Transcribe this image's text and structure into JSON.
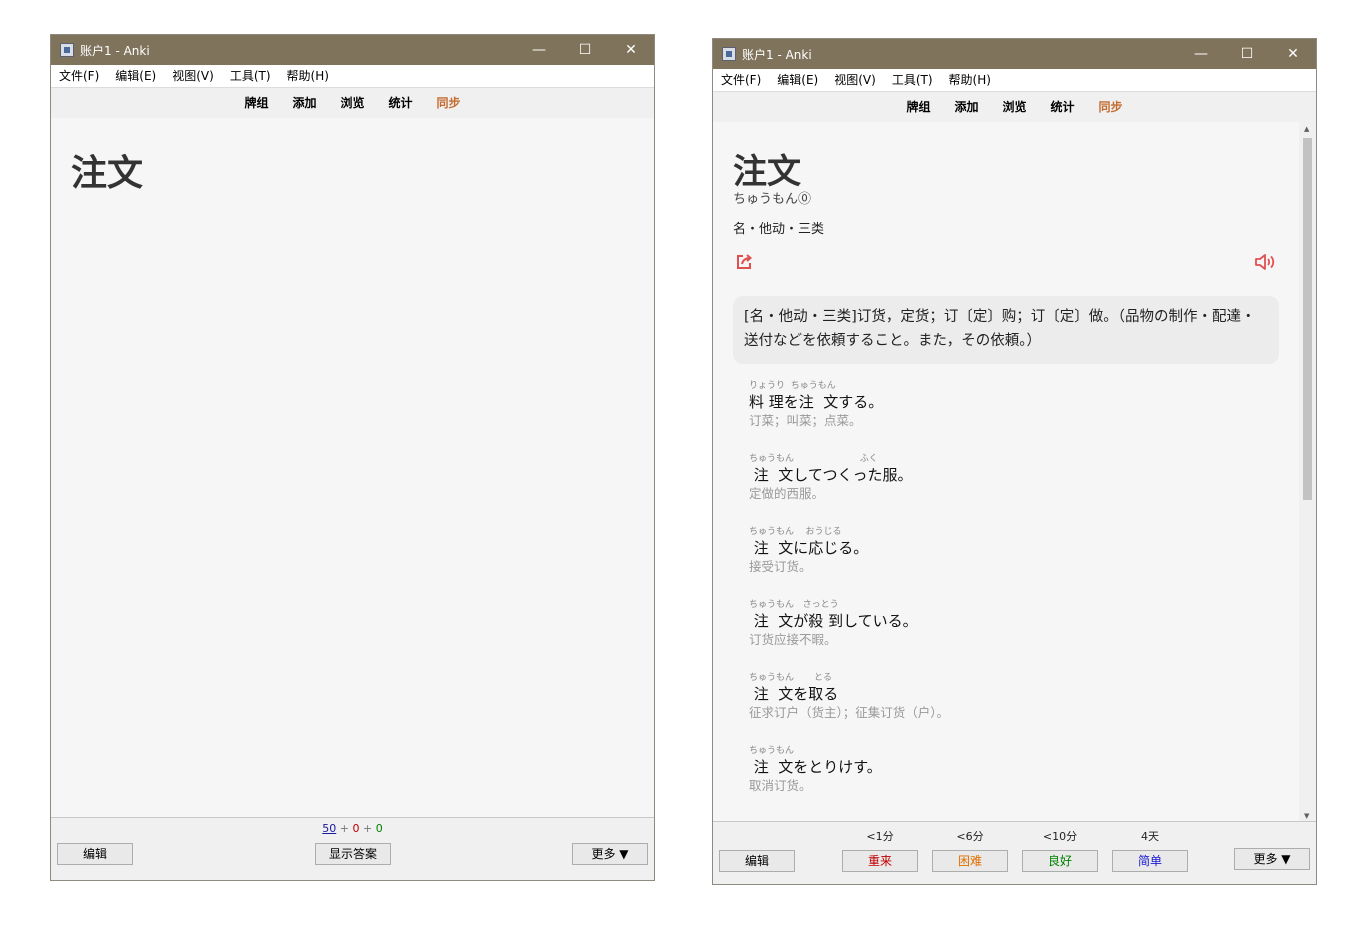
{
  "window_left": {
    "title": "账户1 - Anki",
    "menu": [
      "文件(F)",
      "编辑(E)",
      "视图(V)",
      "工具(T)",
      "帮助(H)"
    ],
    "toolbar": [
      "牌组",
      "添加",
      "浏览",
      "统计",
      "同步"
    ],
    "card_front": "注文",
    "counts": {
      "new": "50",
      "sep": "+",
      "learn": "0",
      "review": "0"
    },
    "edit_label": "编辑",
    "show_answer_label": "显示答案",
    "more_label": "更多 ▼"
  },
  "window_right": {
    "title": "账户1 - Anki",
    "menu": [
      "文件(F)",
      "编辑(E)",
      "视图(V)",
      "工具(T)",
      "帮助(H)"
    ],
    "toolbar": [
      "牌组",
      "添加",
      "浏览",
      "统计",
      "同步"
    ],
    "word": "注文",
    "reading": "ちゅうもん⓪",
    "part_of_speech": "名・他动・三类",
    "definition": "[名・他动・三类]订货，定货；订〔定〕购；订〔定〕做。（品物の制作・配達・送付などを依頼すること。また，その依頼。）",
    "examples": [
      {
        "ruby": "りょうり  ちゅうもん",
        "jp": "料 理を注  文する。",
        "cn": "订菜；叫菜；点菜。"
      },
      {
        "ruby": "ちゅうもん                       ふく",
        "jp": " 注  文してつくった服。",
        "cn": "定做的西服。"
      },
      {
        "ruby": "ちゅうもん    おうじる",
        "jp": " 注  文に応じる。",
        "cn": "接受订货。"
      },
      {
        "ruby": "ちゅうもん   さっとう",
        "jp": " 注  文が殺 到している。",
        "cn": "订货应接不暇。"
      },
      {
        "ruby": "ちゅうもん       とる",
        "jp": " 注  文を取る",
        "cn": "征求订户（货主）；征集订货（户）。"
      },
      {
        "ruby": "ちゅうもん",
        "jp": " 注  文をとりけす。",
        "cn": "取消订货。"
      }
    ],
    "intervals": [
      "<1分",
      "<6分",
      "<10分",
      "4天"
    ],
    "answers": [
      "重来",
      "困难",
      "良好",
      "简单"
    ],
    "edit_label": "编辑",
    "more_label": "更多 ▼"
  },
  "window_controls": {
    "minimize": "—",
    "maximize": "☐",
    "close": "✕"
  },
  "colors": {
    "titlebar": "#7f735c",
    "sync": "#c36b31",
    "again": "#c00000",
    "hard": "#e07000",
    "good": "#008000",
    "easy": "#1a1ad0",
    "icon_red": "#e05050"
  }
}
